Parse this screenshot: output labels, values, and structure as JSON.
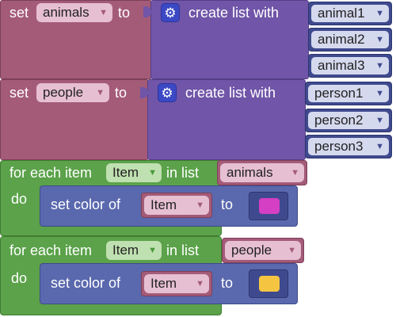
{
  "set_blocks": [
    {
      "set_label": "set",
      "var_name": "animals",
      "to_label": "to",
      "create_list_label": "create list with",
      "items": [
        "animal1",
        "animal2",
        "animal3"
      ]
    },
    {
      "set_label": "set",
      "var_name": "people",
      "to_label": "to",
      "create_list_label": "create list with",
      "items": [
        "person1",
        "person2",
        "person3"
      ]
    }
  ],
  "for_each_blocks": [
    {
      "for_each_label": "for each item",
      "item_var": "Item",
      "in_list_label": "in list",
      "list_var": "animals",
      "do_label": "do",
      "set_color_label": "set color of",
      "target_var": "Item",
      "to_label": "to",
      "color": "#d43fc4"
    },
    {
      "for_each_label": "for each item",
      "item_var": "Item",
      "in_list_label": "in list",
      "list_var": "people",
      "do_label": "do",
      "set_color_label": "set color of",
      "target_var": "Item",
      "to_label": "to",
      "color": "#f5c542"
    }
  ],
  "icons": {
    "gear": "gear-icon",
    "dropdown": "triangle-down-icon"
  }
}
